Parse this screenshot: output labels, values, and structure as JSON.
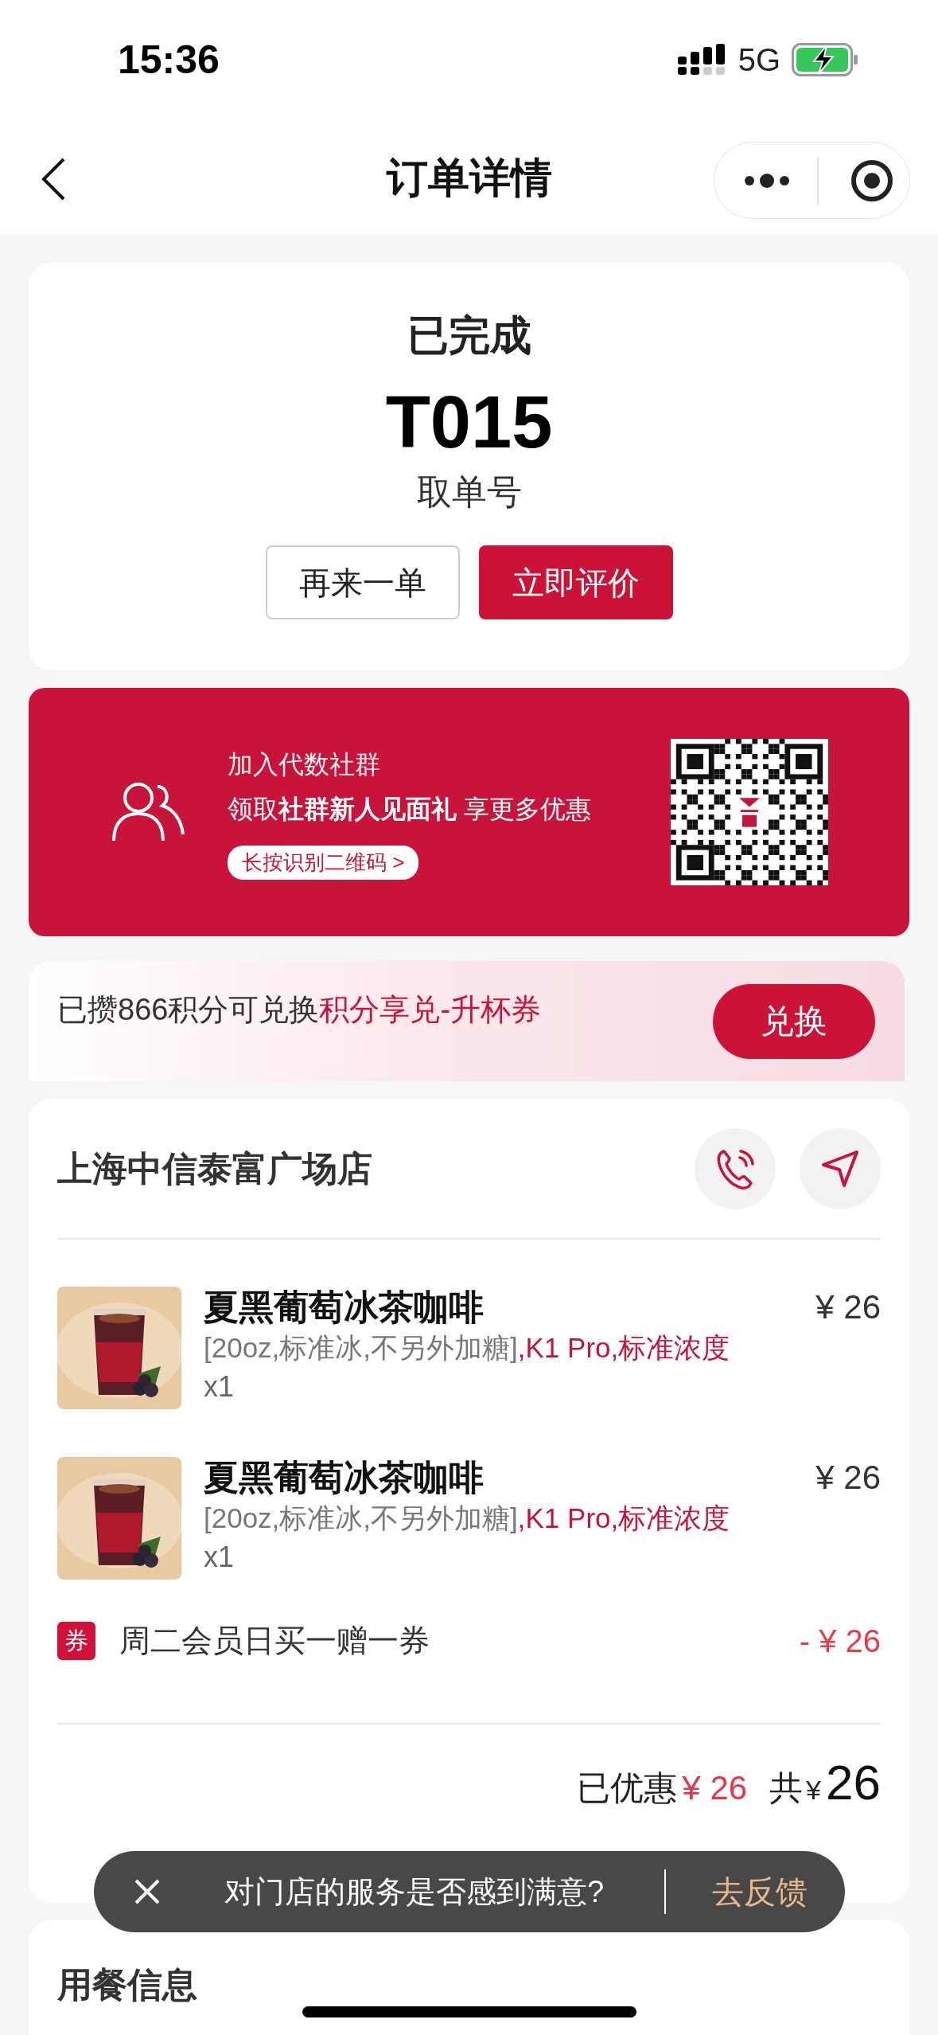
{
  "status_bar": {
    "time": "15:36",
    "network": "5G"
  },
  "nav": {
    "title": "订单详情"
  },
  "order": {
    "status": "已完成",
    "pickup_number": "T015",
    "pickup_label": "取单号",
    "buttons": [
      {
        "label": "再来一单",
        "kind": "outline"
      },
      {
        "label": "立即评价",
        "kind": "primary"
      }
    ]
  },
  "community_banner": {
    "title": "加入代数社群",
    "subtitle": "领取**社群新人见面礼** 享更多优惠",
    "link": "长按识别二维码 >"
  },
  "points": {
    "text": "已攒866积分可兑换",
    "highlight": "积分享兑-升杯券",
    "button": "兑换"
  },
  "store": {
    "name": "上海中信泰富广场店",
    "items": [
      {
        "name": "夏黑葡萄冰茶咖啡",
        "spec": "[20oz,标准冰,不另外加糖]",
        "spec_extra": ",K1 Pro,标准浓度",
        "quantity": "x1",
        "price": "¥ 26"
      },
      {
        "name": "夏黑葡萄冰茶咖啡",
        "spec": "[20oz,标准冰,不另外加糖]",
        "spec_extra": ",K1 Pro,标准浓度",
        "quantity": "x1",
        "price": "¥ 26"
      }
    ],
    "coupon": {
      "badge": "券",
      "name": "周二会员日买一赠一券",
      "amount": "- ¥ 26"
    },
    "totals": {
      "discount_label": "已优惠",
      "discount": "¥ 26",
      "total_label": "共",
      "currency": "¥",
      "total": "26"
    }
  },
  "toast": {
    "message": "对门店的服务是否感到满意?",
    "action": "去反馈"
  },
  "dining_info": {
    "title": "用餐信息"
  }
}
